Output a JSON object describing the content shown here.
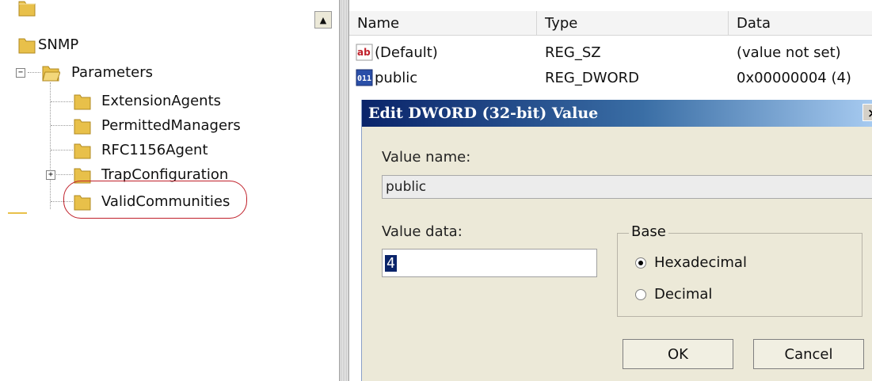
{
  "tree": {
    "items": [
      {
        "label": "SNMP",
        "level": 0
      },
      {
        "label": "Parameters",
        "level": 1,
        "expander": "−"
      },
      {
        "label": "ExtensionAgents",
        "level": 2
      },
      {
        "label": "PermittedManagers",
        "level": 2
      },
      {
        "label": "RFC1156Agent",
        "level": 2
      },
      {
        "label": "TrapConfiguration",
        "level": 2,
        "expander": "+"
      },
      {
        "label": "ValidCommunities",
        "level": 2,
        "highlighted": true
      }
    ]
  },
  "list": {
    "columns": {
      "name": "Name",
      "type": "Type",
      "data": "Data"
    },
    "rows": [
      {
        "icon": "string-value-icon",
        "icon_text": "ab",
        "name": "(Default)",
        "type": "REG_SZ",
        "data": "(value not set)"
      },
      {
        "icon": "binary-value-icon",
        "icon_text": "011",
        "name": "public",
        "type": "REG_DWORD",
        "data": "0x00000004 (4)"
      }
    ]
  },
  "dialog": {
    "title": "Edit DWORD (32-bit) Value",
    "close_glyph": "×",
    "value_name_label": "Value name:",
    "value_name": "public",
    "value_data_label": "Value data:",
    "value_data": "4",
    "base_label": "Base",
    "base_options": [
      {
        "label": "Hexadecimal",
        "checked": true
      },
      {
        "label": "Decimal",
        "checked": false
      }
    ],
    "ok_label": "OK",
    "cancel_label": "Cancel"
  },
  "colors": {
    "folder": "#e8c04a",
    "highlight_ring": "#c0202a",
    "title_bar": "#0a246a"
  }
}
